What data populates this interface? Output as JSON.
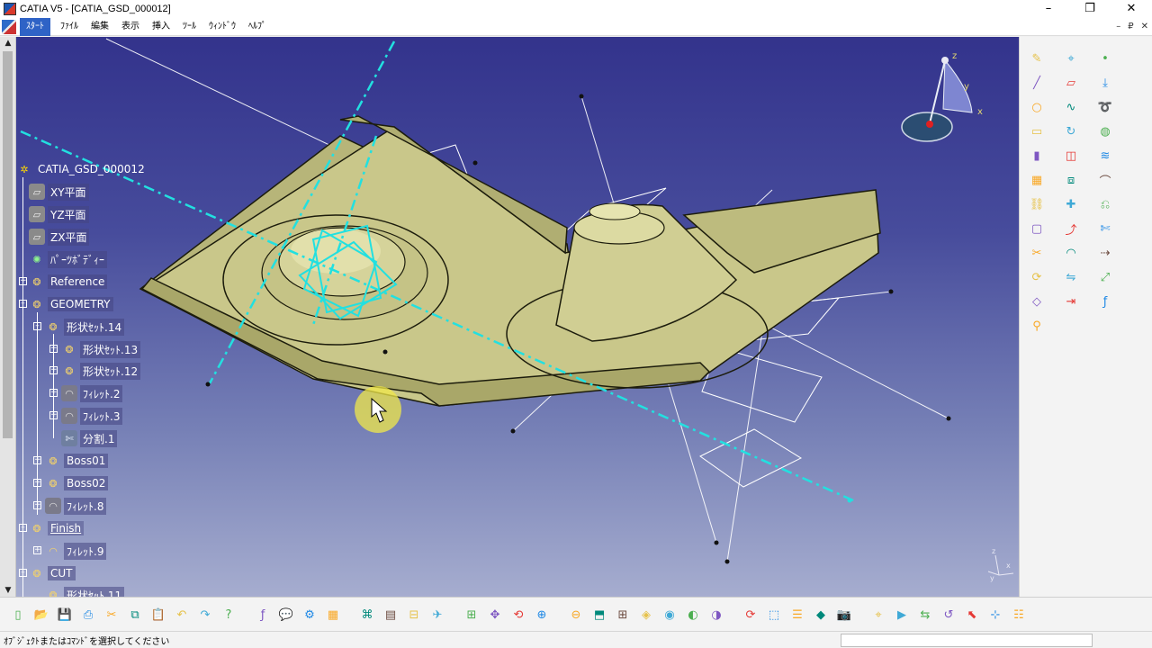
{
  "window": {
    "title": "CATIA V5 - [CATIA_GSD_000012]",
    "controls": [
      "–",
      "❐",
      "✕"
    ]
  },
  "menubar": {
    "start": "ｽﾀｰﾄ",
    "items": [
      "ﾌｧｲﾙ",
      "編集",
      "表示",
      "挿入",
      "ﾂｰﾙ",
      "ｳｨﾝﾄﾞｳ",
      "ﾍﾙﾌﾟ"
    ],
    "doc_controls": [
      "–",
      "₽",
      "✕"
    ]
  },
  "tree": {
    "root": "CATIA_GSD_000012",
    "nodes": [
      {
        "label": "XY平面",
        "icon": "plane-icon"
      },
      {
        "label": "YZ平面",
        "icon": "plane-icon"
      },
      {
        "label": "ZX平面",
        "icon": "plane-icon"
      },
      {
        "label": "ﾊﾟｰﾂﾎﾞﾃﾞｨｰ",
        "icon": "gear-icon"
      },
      {
        "label": "Reference",
        "icon": "geometrical-set-icon"
      },
      {
        "label": "GEOMETRY",
        "icon": "geometrical-set-icon"
      },
      {
        "label": "形状ｾｯﾄ.14",
        "icon": "geometrical-set-icon"
      },
      {
        "label": "形状ｾｯﾄ.13",
        "icon": "geometrical-set-icon"
      },
      {
        "label": "形状ｾｯﾄ.12",
        "icon": "geometrical-set-icon"
      },
      {
        "label": "ﾌｨﾚｯﾄ.2",
        "icon": "fillet-icon"
      },
      {
        "label": "ﾌｨﾚｯﾄ.3",
        "icon": "fillet-icon"
      },
      {
        "label": "分割.1",
        "icon": "split-icon"
      },
      {
        "label": "Boss01",
        "icon": "geometrical-set-icon"
      },
      {
        "label": "Boss02",
        "icon": "geometrical-set-icon"
      },
      {
        "label": "ﾌｨﾚｯﾄ.8",
        "icon": "fillet-icon"
      },
      {
        "label": "Finish",
        "icon": "geometrical-set-icon"
      },
      {
        "label": "ﾌｨﾚｯﾄ.9",
        "icon": "fillet-icon"
      },
      {
        "label": "CUT",
        "icon": "geometrical-set-icon"
      },
      {
        "label": "形状ｾｯﾄ.11",
        "icon": "geometrical-set-icon"
      }
    ]
  },
  "compass": {
    "x": "x",
    "y": "y",
    "z": "z"
  },
  "axis_indicator": {
    "x": "x",
    "y": "y",
    "z": "z"
  },
  "statusbar": {
    "prompt": "ｵﾌﾞｼﾞｪｸﾄまたはｺﾏﾝﾄﾞを選択してください"
  },
  "colors": {
    "viewport_top": "#33338c",
    "viewport_bottom": "#a6adcf",
    "part_surface": "#c9c78a",
    "selection_cyan": "#22e0e0",
    "title_start": "#2f63c6"
  },
  "right_toolbar_icons": [
    "sketch-icon",
    "axis-system-icon",
    "point-icon",
    "line-icon",
    "plane-icon",
    "projection-icon",
    "circle-icon",
    "spline-icon",
    "helix-icon",
    "extrude-icon",
    "revolve-icon",
    "sphere-icon",
    "cylinder-icon",
    "offset-icon",
    "sweep-icon",
    "fill-icon",
    "loft-icon",
    "blend-icon",
    "join-icon",
    "healing-icon",
    "untrim-icon",
    "boundary-icon",
    "extract-icon",
    "split-icon",
    "trim-icon",
    "fillet-icon",
    "translate-icon",
    "rotate-icon",
    "symmetry-icon",
    "scaling-icon",
    "affinity-icon",
    "extrapolate-icon",
    "law-icon",
    "analysis-icon"
  ],
  "bottom_toolbar_icons": [
    "new-icon",
    "open-icon",
    "save-icon",
    "print-icon",
    "cut-icon",
    "copy-icon",
    "paste-icon",
    "undo-icon",
    "redo-icon",
    "whats-this-icon",
    "formula-icon",
    "comment-icon",
    "parameter-icon",
    "table-icon",
    "tree-icon",
    "catalog-icon",
    "measure-icon",
    "fly-mode-icon",
    "fit-all-icon",
    "pan-icon",
    "rotate-view-icon",
    "zoom-in-icon",
    "zoom-out-icon",
    "normal-view-icon",
    "multi-view-icon",
    "iso-view-icon",
    "shading-icon",
    "hide-show-icon",
    "swap-visible-icon",
    "update-icon",
    "wireframe-icon",
    "properties-icon",
    "render-icon",
    "camera-icon",
    "scan-icon",
    "macro-icon",
    "instant-icon",
    "repeat-icon",
    "select-icon",
    "compass-icon",
    "layers-icon"
  ]
}
